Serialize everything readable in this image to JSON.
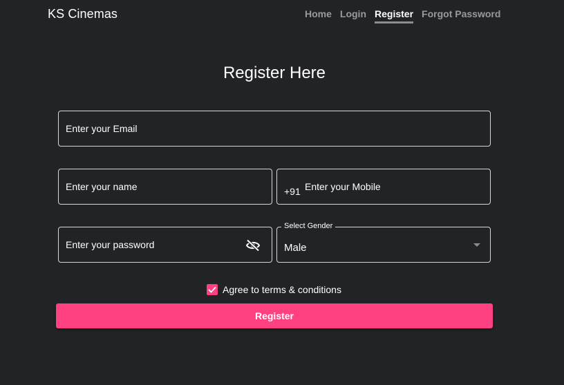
{
  "header": {
    "brand": "KS Cinemas",
    "nav": [
      {
        "label": "Home",
        "active": false
      },
      {
        "label": "Login",
        "active": false
      },
      {
        "label": "Register",
        "active": true
      },
      {
        "label": "Forgot Password",
        "active": false
      }
    ]
  },
  "form": {
    "title": "Register Here",
    "email_placeholder": "Enter your Email",
    "name_placeholder": "Enter your name",
    "mobile_prefix": "+91",
    "mobile_placeholder": "Enter your Mobile",
    "password_placeholder": "Enter your password",
    "gender_label": "Select Gender",
    "gender_value": "Male",
    "agree_label": "Agree to terms & conditions",
    "agree_checked": true,
    "submit_label": "Register"
  },
  "icons": {
    "password_toggle": "eye-off-icon",
    "checkbox": "check-icon",
    "dropdown": "caret-down-icon"
  },
  "colors": {
    "background": "#212327",
    "accent": "#ff4081",
    "border": "#d9d9d9",
    "nav_inactive": "#9a9a9a"
  }
}
